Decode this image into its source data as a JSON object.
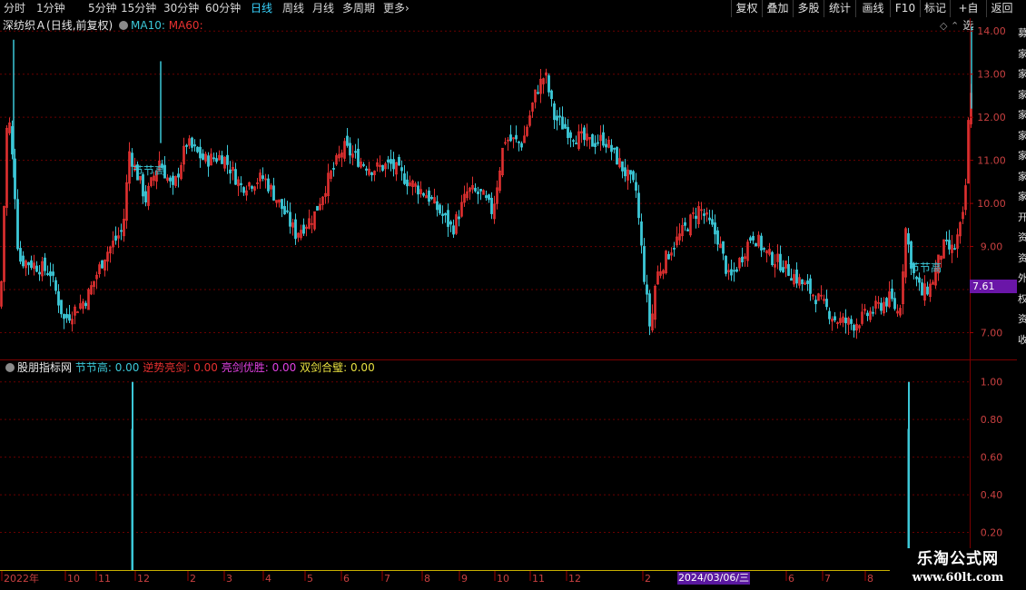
{
  "toolbar": {
    "periods": [
      "分时",
      "1分钟",
      "5分钟",
      "15分钟",
      "30分钟",
      "60分钟",
      "日线",
      "周线",
      "月线",
      "多周期",
      "更多"
    ],
    "active_period": "日线",
    "more_icon": "chevron-right-icon",
    "right_buttons": [
      "复权",
      "叠加",
      "多股",
      "统计",
      "画线",
      "F10",
      "标记",
      "+自选",
      "返回"
    ]
  },
  "main_chart": {
    "stock_title": "深纺织Ａ",
    "mode": "(日线,前复权)",
    "ma10_label": "MA10:",
    "ma60_label": "MA60:",
    "marker_label": "节节高",
    "current_price": "7.61",
    "y_ticks": [
      "14.00",
      "13.00",
      "12.00",
      "11.00",
      "10.00",
      "9.00",
      "8.00",
      "7.00"
    ],
    "corner_icons": [
      "diamond-icon",
      "chevron-up-icon",
      "chevron-down-icon"
    ]
  },
  "indicator": {
    "name": "股朋指标网",
    "items": [
      {
        "label": "节节高:",
        "value": "0.00",
        "color": "#3cc8d8"
      },
      {
        "label": "逆势亮剑:",
        "value": "0.00",
        "color": "#e83030"
      },
      {
        "label": "亮剑优胜:",
        "value": "0.00",
        "color": "#e040e0"
      },
      {
        "label": "双剑合璧:",
        "value": "0.00",
        "color": "#e8e040"
      }
    ],
    "y_ticks": [
      "1.00",
      "0.80",
      "0.60",
      "0.40",
      "0.20"
    ]
  },
  "x_axis": {
    "labels": [
      "2022年",
      "10",
      "11",
      "12",
      "2",
      "3",
      "4",
      "5",
      "6",
      "7",
      "8",
      "9",
      "10",
      "11",
      "12",
      "2",
      "3",
      "6",
      "7",
      "8"
    ],
    "selected_date": "2024/03/06/三"
  },
  "watermark": {
    "line1": "乐淘公式网",
    "line2": "www.60lt.com"
  },
  "right_strip_chars": [
    "募",
    "家",
    "家",
    "家",
    "家",
    "家",
    "家",
    "家",
    "家",
    "开",
    "资",
    "资",
    "外",
    "权",
    "资",
    "收"
  ],
  "chart_data": {
    "type": "candlestick",
    "approx_close_path": [
      [
        0,
        7.6
      ],
      [
        8,
        12.3
      ],
      [
        15,
        10.6
      ],
      [
        20,
        8.7
      ],
      [
        35,
        8.6
      ],
      [
        55,
        8.4
      ],
      [
        70,
        7.3
      ],
      [
        95,
        7.8
      ],
      [
        115,
        8.8
      ],
      [
        135,
        9.4
      ],
      [
        142,
        11.2
      ],
      [
        160,
        10.1
      ],
      [
        175,
        11.0
      ],
      [
        190,
        10.3
      ],
      [
        205,
        11.4
      ],
      [
        225,
        11.0
      ],
      [
        245,
        11.1
      ],
      [
        265,
        10.4
      ],
      [
        290,
        10.6
      ],
      [
        310,
        9.9
      ],
      [
        325,
        9.3
      ],
      [
        345,
        9.7
      ],
      [
        360,
        10.5
      ],
      [
        378,
        11.3
      ],
      [
        395,
        11.0
      ],
      [
        410,
        10.8
      ],
      [
        430,
        10.9
      ],
      [
        450,
        10.5
      ],
      [
        470,
        10.2
      ],
      [
        498,
        9.4
      ],
      [
        515,
        10.3
      ],
      [
        530,
        10.2
      ],
      [
        542,
        9.8
      ],
      [
        555,
        11.5
      ],
      [
        575,
        11.4
      ],
      [
        590,
        12.6
      ],
      [
        600,
        13.0
      ],
      [
        610,
        12.0
      ],
      [
        630,
        11.6
      ],
      [
        650,
        11.4
      ],
      [
        665,
        11.5
      ],
      [
        680,
        11.0
      ],
      [
        700,
        10.3
      ],
      [
        708,
        8.5
      ],
      [
        716,
        7.0
      ],
      [
        722,
        8.3
      ],
      [
        740,
        9.0
      ],
      [
        770,
        9.9
      ],
      [
        790,
        9.2
      ],
      [
        803,
        8.2
      ],
      [
        815,
        8.7
      ],
      [
        828,
        9.3
      ],
      [
        845,
        8.8
      ],
      [
        860,
        8.6
      ],
      [
        880,
        8.2
      ],
      [
        900,
        7.8
      ],
      [
        920,
        7.3
      ],
      [
        940,
        7.2
      ],
      [
        960,
        7.5
      ],
      [
        980,
        7.8
      ],
      [
        990,
        7.4
      ],
      [
        997,
        9.4
      ],
      [
        1005,
        8.4
      ],
      [
        1015,
        7.9
      ],
      [
        1025,
        8.1
      ],
      [
        1038,
        9.0
      ],
      [
        1050,
        8.9
      ],
      [
        1062,
        9.8
      ],
      [
        1065,
        11.6
      ],
      [
        1068,
        12.3
      ],
      [
        1072,
        13.8
      ]
    ],
    "indicator_spikes": [
      {
        "series": "节节高",
        "x_date_index": 146,
        "value": 1.0
      },
      {
        "series": "节节高",
        "x_date_index": 1001,
        "value": 1.0
      }
    ],
    "price_ylim": [
      6.4,
      14.3
    ],
    "indicator_ylim": [
      0,
      1.1
    ]
  },
  "colors": {
    "up": "#e03030",
    "down": "#3cc8d8",
    "grid": "#6a0000",
    "axis_text": "#c84040",
    "background": "#000000"
  }
}
